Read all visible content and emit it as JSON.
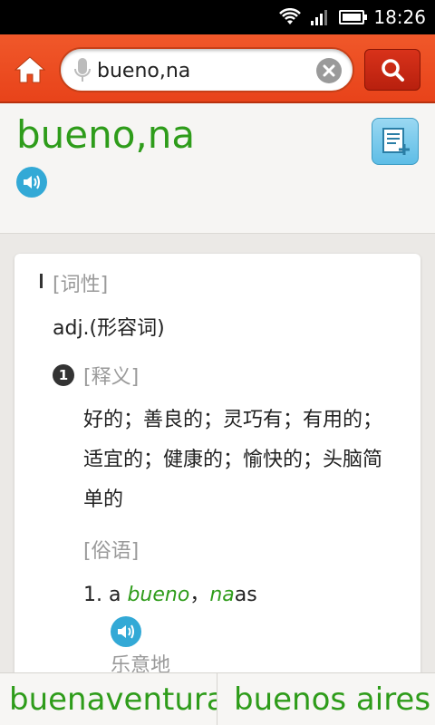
{
  "status": {
    "time": "18:26"
  },
  "search": {
    "value": "bueno,na"
  },
  "entry": {
    "headword": "bueno,na",
    "pos_label": "[词性]",
    "pos_value": "adj.(形容词)",
    "sense_number": "1",
    "sense_label": "[释义]",
    "sense_text": "好的；善良的；灵巧有；有用的；适宜的；健康的；愉快的；头脑简单的",
    "idiom_label": "[俗语]",
    "example": {
      "prefix": "1. a ",
      "word1": "bueno",
      "sep": "，",
      "word2": "na",
      "suffix": "as"
    },
    "translation": "乐意地"
  },
  "nav": {
    "prev": "buenaventura",
    "next": "buenos aires"
  },
  "colors": {
    "accent": "#e8431a",
    "headword": "#2e9c1a",
    "speaker": "#33a9d6"
  }
}
